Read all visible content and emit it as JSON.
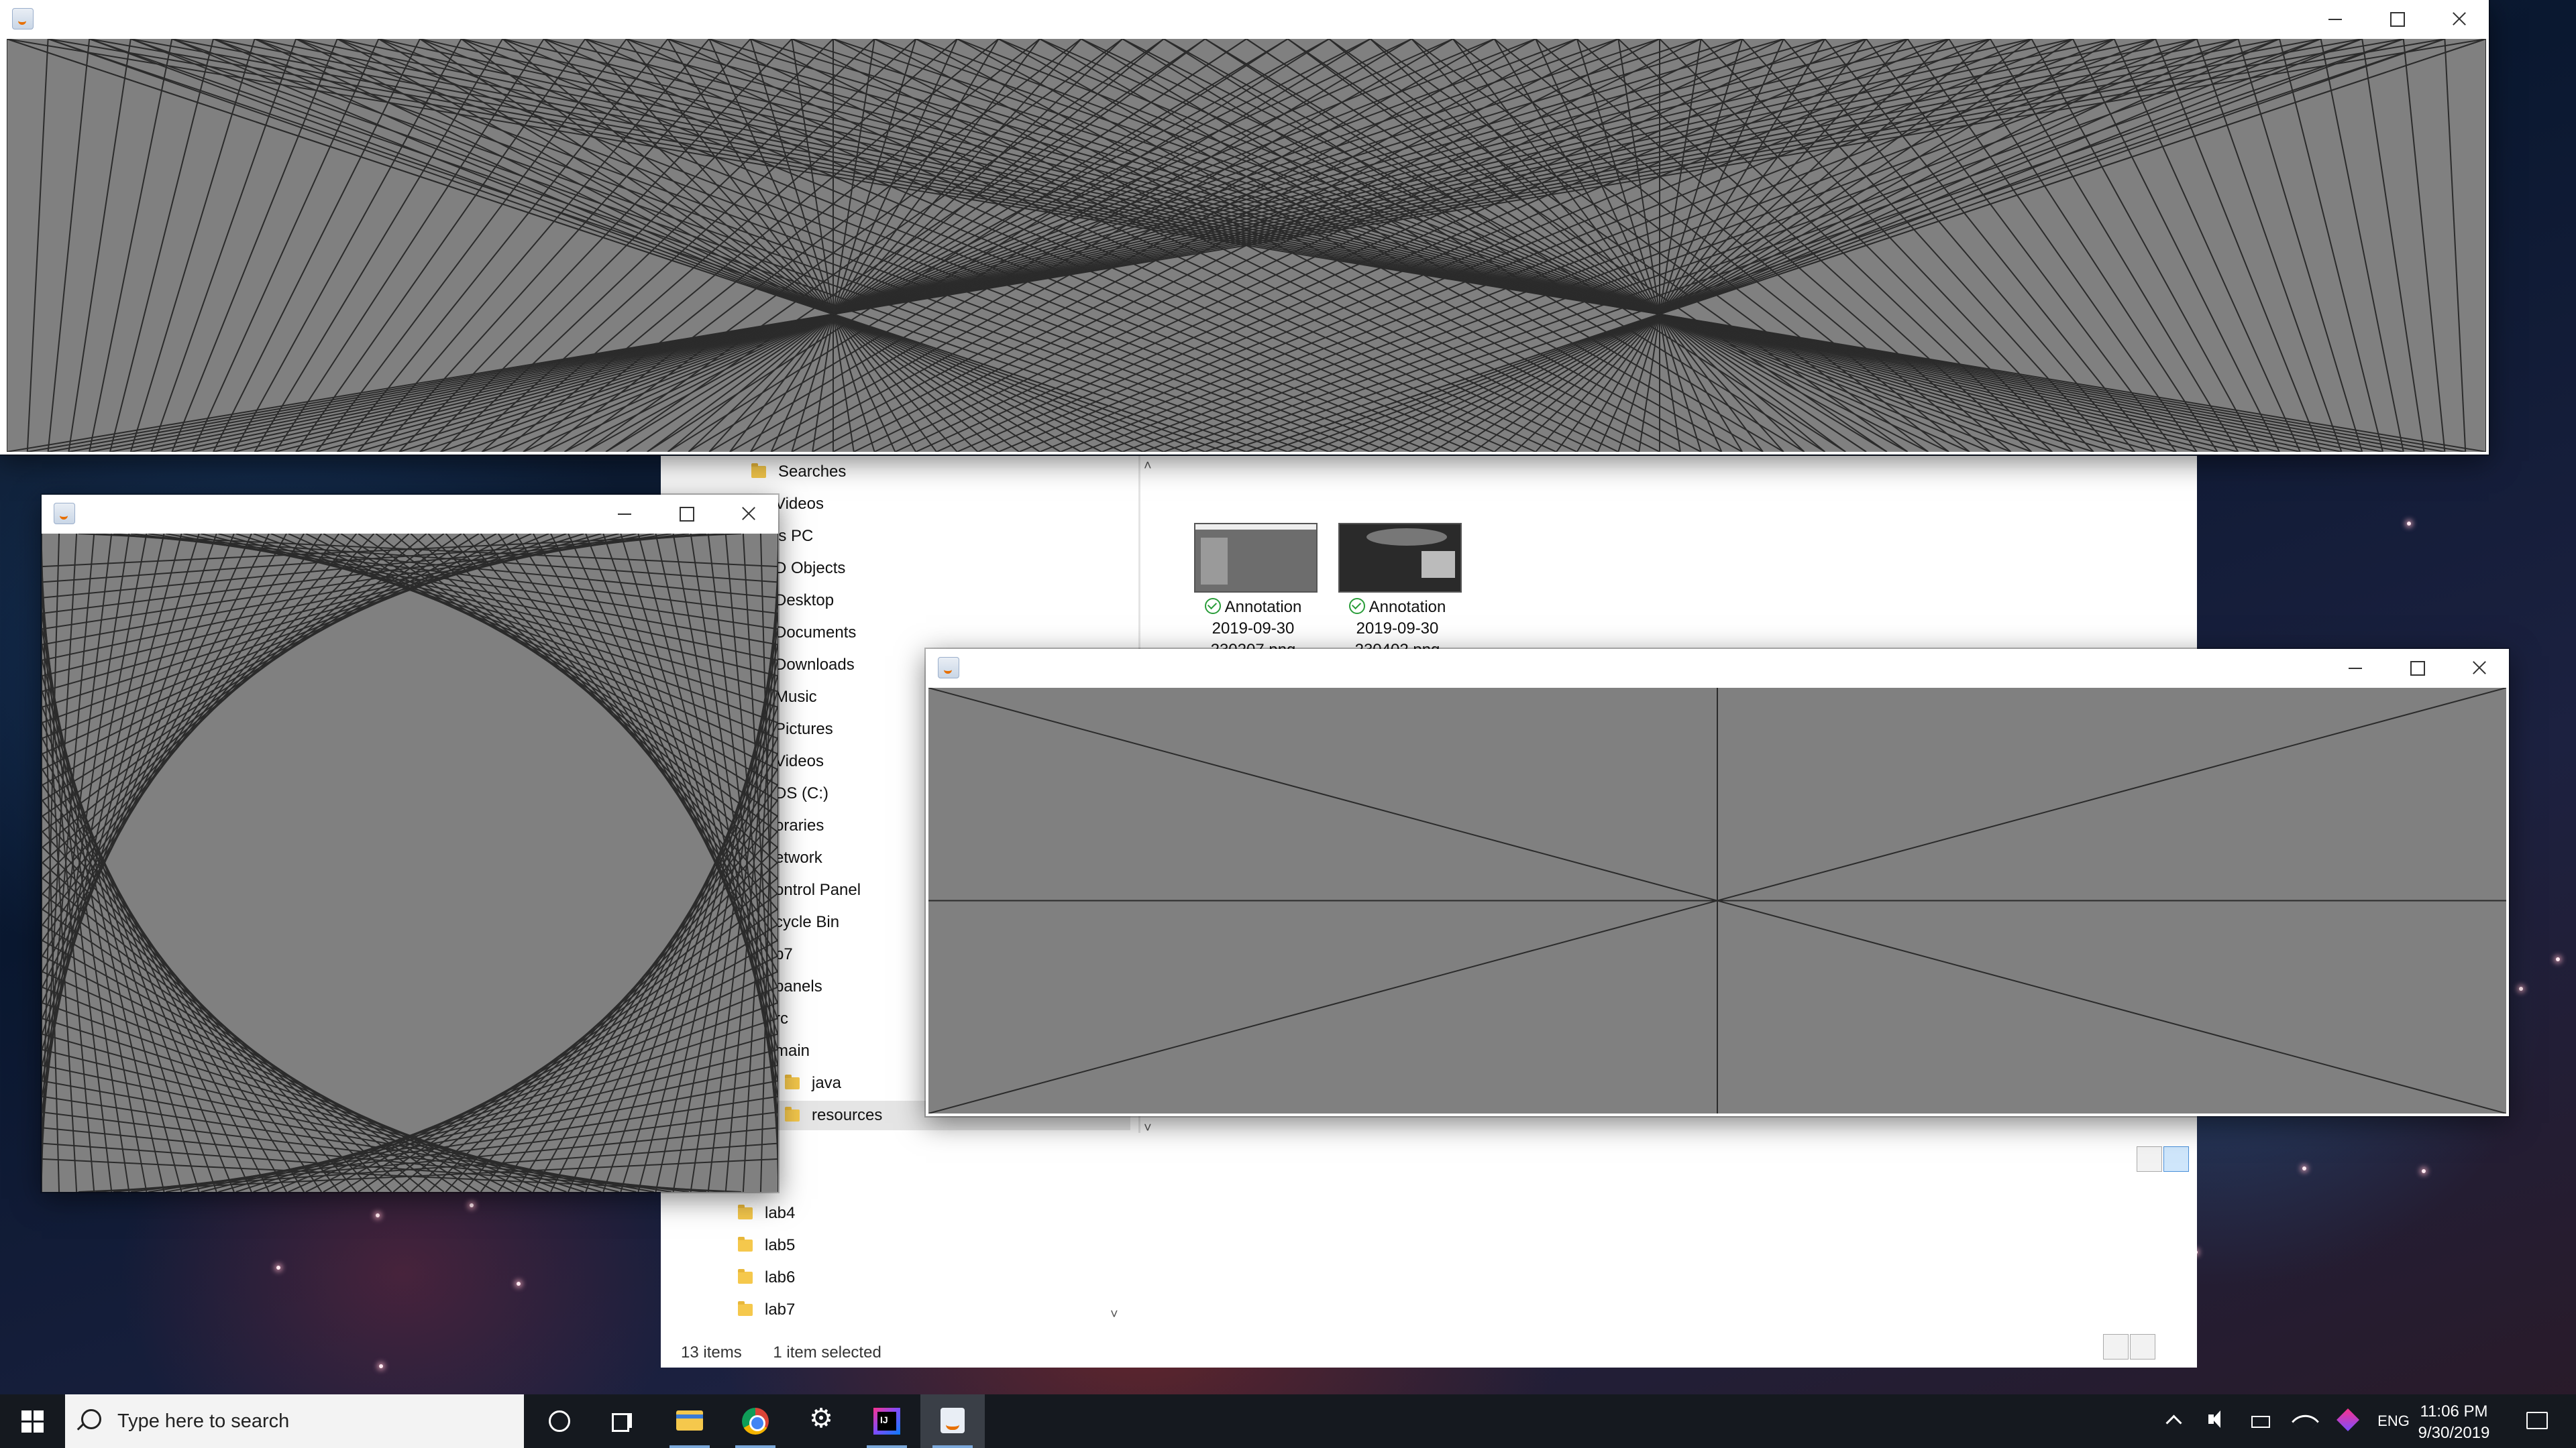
{
  "windows": {
    "top_java": {
      "title": ""
    },
    "left_java": {
      "title": ""
    },
    "right_java": {
      "title": ""
    }
  },
  "explorer": {
    "nav_items": [
      "Searches",
      "Videos",
      "is PC",
      "D Objects",
      "Desktop",
      "Documents",
      "Downloads",
      "Music",
      "Pictures",
      "Videos",
      "DS (C:)",
      "oraries",
      "etwork",
      "ontrol Panel",
      "cycle Bin",
      "b7",
      "panels",
      "rc",
      "main",
      "java",
      "resources"
    ],
    "nav_items_lower": [
      "adle",
      "lab4",
      "lab5",
      "lab6",
      "lab7"
    ],
    "files": [
      {
        "name_line1": "Annotation",
        "name_line2": "2019-09-30",
        "name_line3": "230207.png"
      },
      {
        "name_line1": "Annotation",
        "name_line2": "2019-09-30",
        "name_line3": "230402.png"
      }
    ],
    "status_items": "13 items",
    "status_selected": "1 item selected"
  },
  "taskbar": {
    "search_placeholder": "Type here to search",
    "language": "ENG",
    "time": "11:06 PM",
    "date": "9/30/2019",
    "pinned_icons": [
      "cortana-icon",
      "task-view-icon",
      "file-explorer-icon",
      "chrome-icon",
      "settings-icon",
      "intellij-icon",
      "java-icon"
    ]
  }
}
